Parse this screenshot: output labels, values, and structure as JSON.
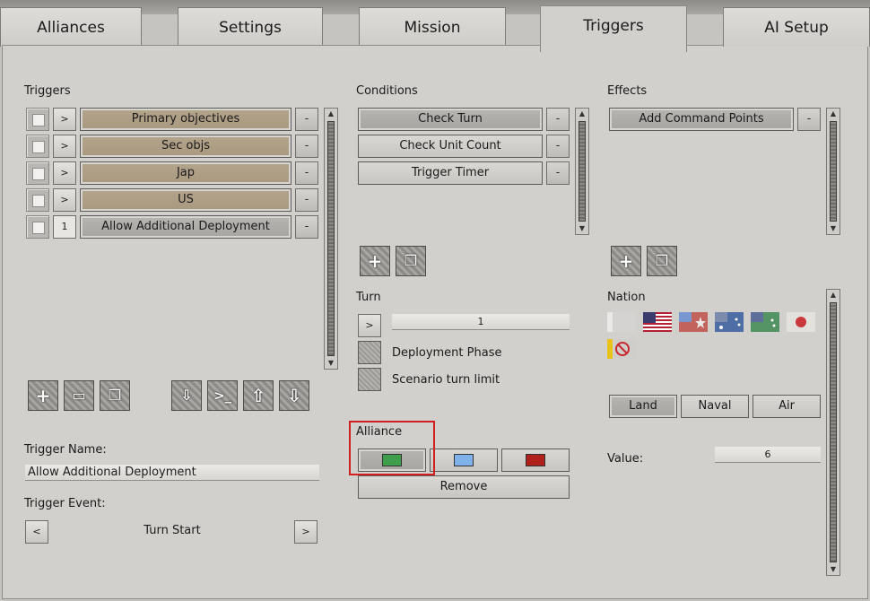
{
  "tabs": [
    "Alliances",
    "Settings",
    "Mission",
    "Triggers",
    "AI Setup"
  ],
  "active_tab": "Triggers",
  "triggers": {
    "label": "Triggers",
    "rows": [
      {
        "expand": ">",
        "name": "Primary objectives",
        "remove": "-"
      },
      {
        "expand": ">",
        "name": "Sec objs",
        "remove": "-"
      },
      {
        "expand": ">",
        "name": "Jap",
        "remove": "-"
      },
      {
        "expand": ">",
        "name": "US",
        "remove": "-"
      },
      {
        "expand": "1",
        "name": "Allow Additional Deployment",
        "remove": "-"
      }
    ],
    "toolbar_icons": [
      "add-icon",
      "folder-icon",
      "copy-icon",
      "import-icon",
      "console-icon",
      "move-up-icon",
      "move-down-icon"
    ]
  },
  "trigger_name": {
    "label": "Trigger Name:",
    "value": "Allow Additional Deployment"
  },
  "trigger_event": {
    "label": "Trigger Event:",
    "prev": "<",
    "value": "Turn Start",
    "next": ">"
  },
  "conditions": {
    "label": "Conditions",
    "rows": [
      {
        "name": "Check Turn",
        "remove": "-"
      },
      {
        "name": "Check Unit Count",
        "remove": "-"
      },
      {
        "name": "Trigger Timer",
        "remove": "-"
      }
    ]
  },
  "turn": {
    "label": "Turn",
    "expand": ">",
    "value": "1",
    "options": [
      "Deployment Phase",
      "Scenario turn limit"
    ]
  },
  "alliance": {
    "label": "Alliance",
    "colors": [
      "#3f9e4c",
      "#7fb2ea",
      "#b0211b"
    ],
    "remove_label": "Remove"
  },
  "effects": {
    "label": "Effects",
    "rows": [
      {
        "name": "Add Command Points",
        "remove": "-"
      }
    ]
  },
  "nation": {
    "label": "Nation",
    "domains": [
      "Land",
      "Naval",
      "Air"
    ]
  },
  "value_field": {
    "label": "Value:",
    "value": "6"
  }
}
